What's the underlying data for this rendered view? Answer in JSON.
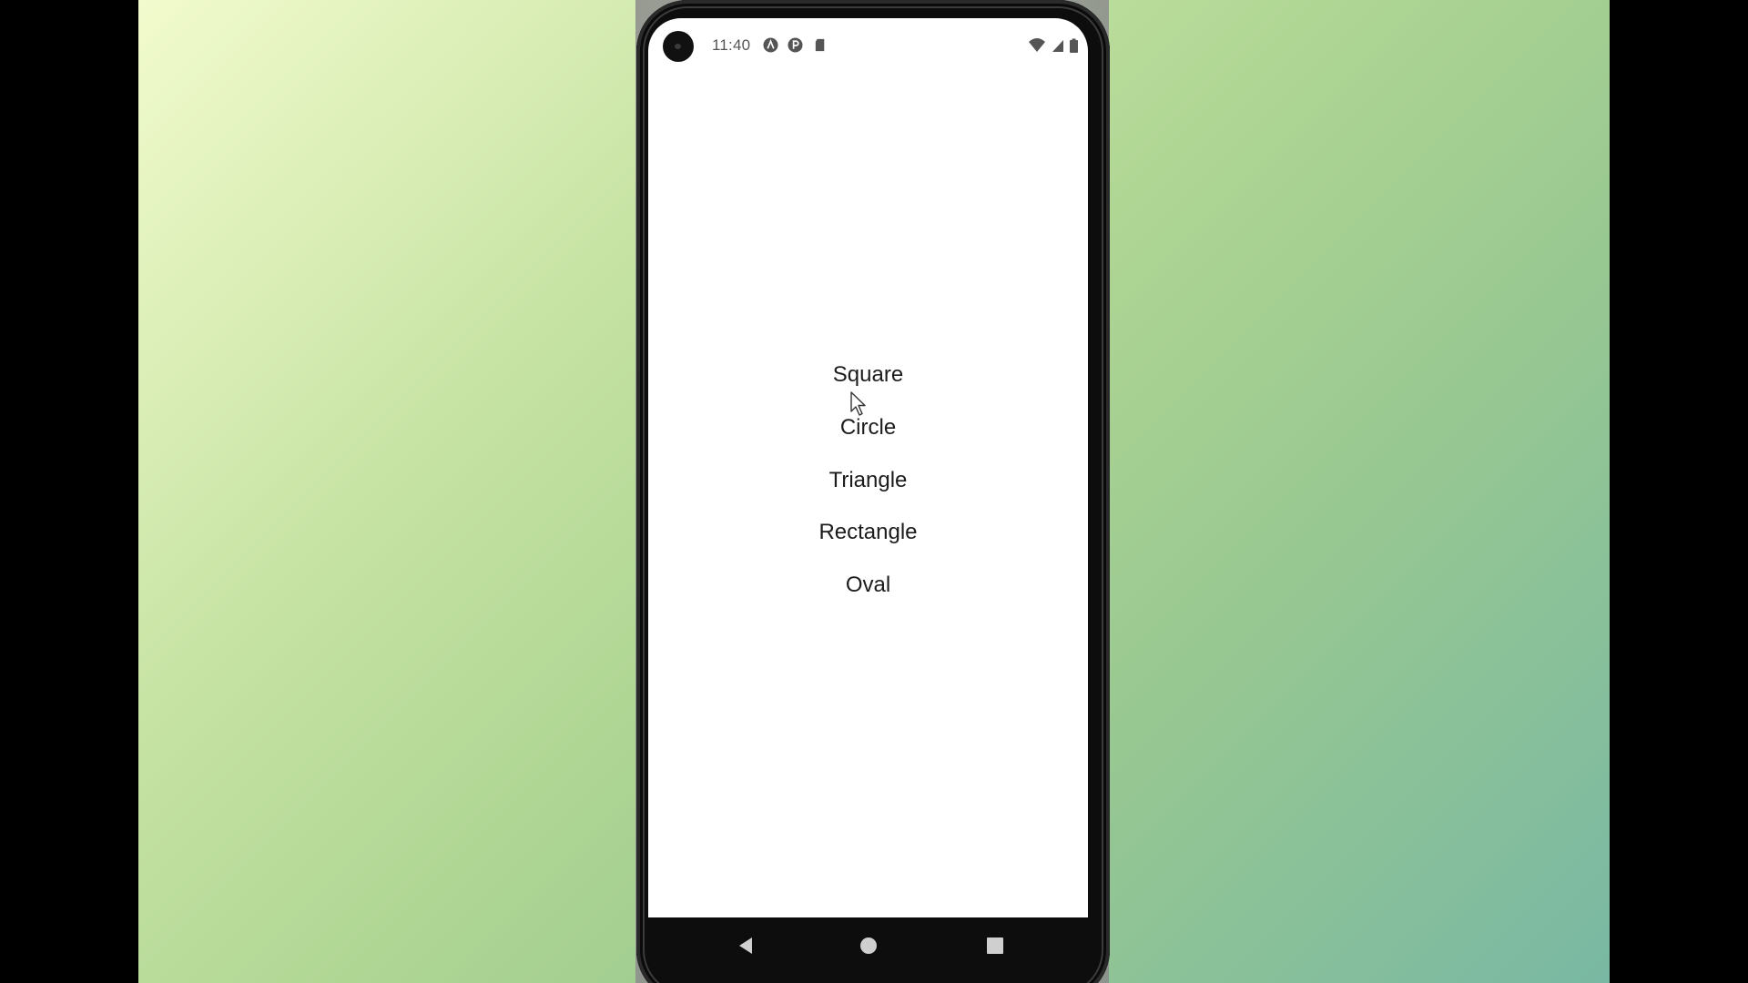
{
  "status_bar": {
    "time": "11:40",
    "left_icons": [
      "camera-cutout",
      "notification-a-icon",
      "notification-p-icon",
      "sd-card-icon"
    ],
    "right_icons": [
      "wifi-icon",
      "signal-icon",
      "battery-icon"
    ]
  },
  "shape_list": {
    "items": [
      {
        "label": "Square"
      },
      {
        "label": "Circle"
      },
      {
        "label": "Triangle"
      },
      {
        "label": "Rectangle"
      },
      {
        "label": "Oval"
      }
    ]
  },
  "nav_bar": {
    "buttons": [
      "back-icon",
      "home-icon",
      "recents-icon"
    ]
  },
  "colors": {
    "screen_background": "#ffffff",
    "text": "#1c1c1c",
    "phone_frame": "#0d0d0d"
  }
}
